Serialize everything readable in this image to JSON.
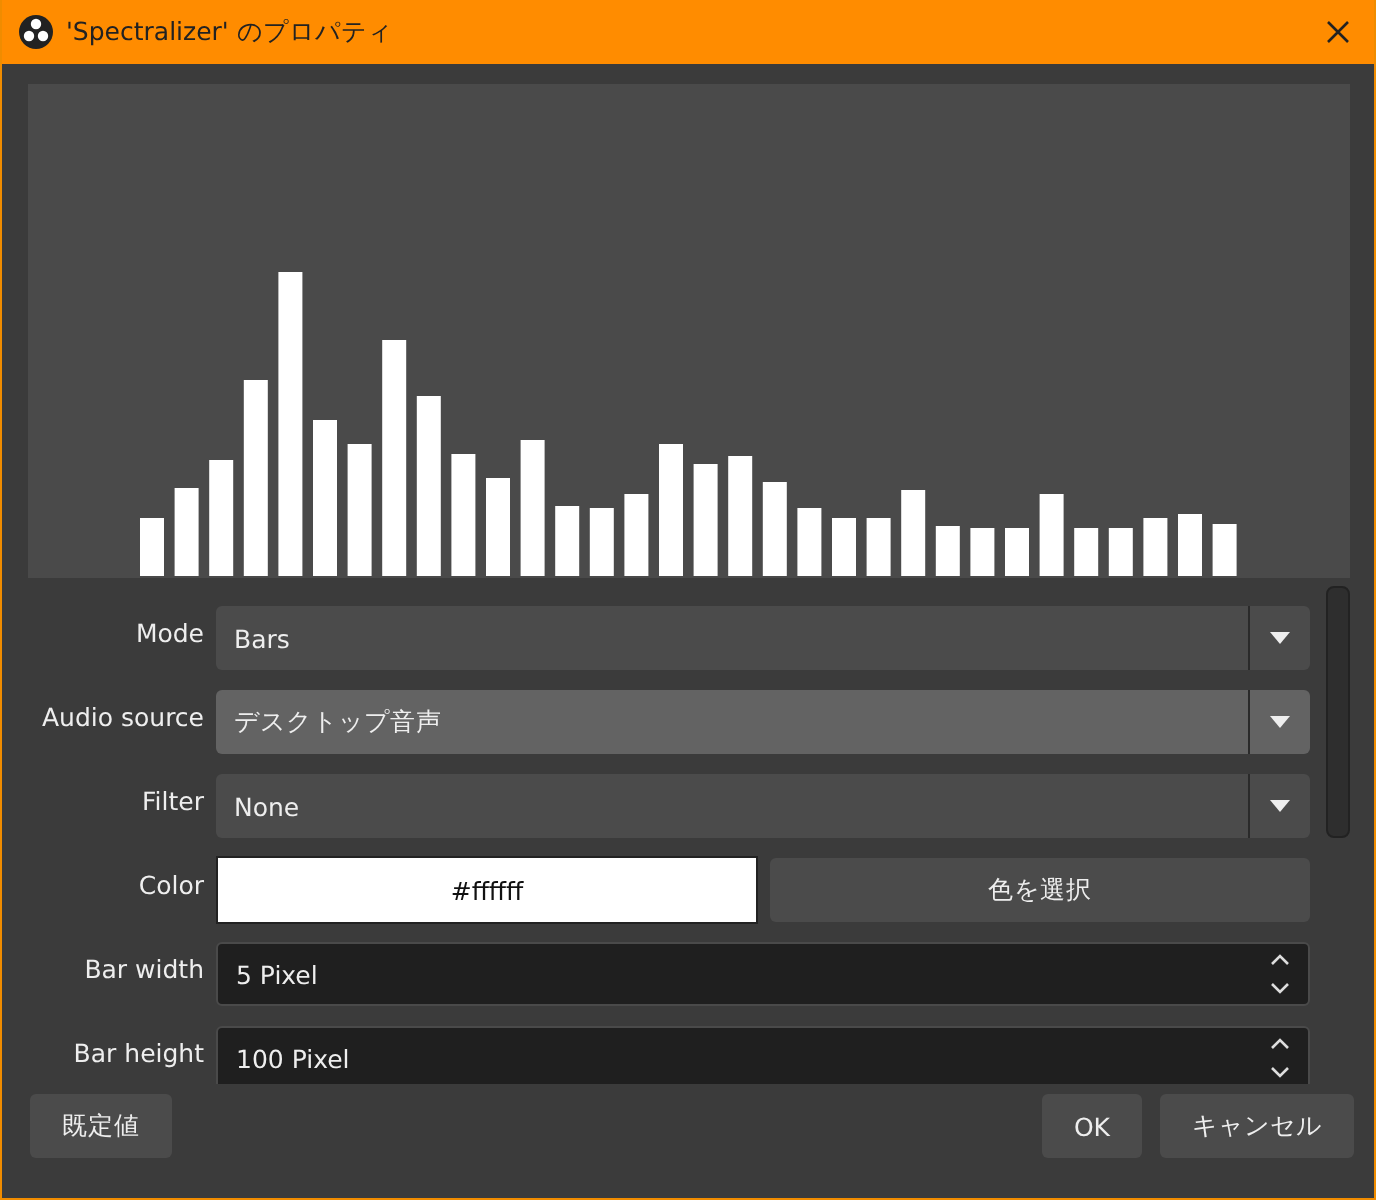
{
  "window": {
    "title": "'Spectralizer' のプロパティ"
  },
  "fields": [
    {
      "kind": "combo",
      "label": "Mode",
      "value": "Bars",
      "highlighted": false
    },
    {
      "kind": "combo",
      "label": "Audio source",
      "value": "デスクトップ音声",
      "highlighted": true
    },
    {
      "kind": "combo",
      "label": "Filter",
      "value": "None",
      "highlighted": false
    },
    {
      "kind": "color",
      "label": "Color",
      "value": "#ffffff",
      "button": "色を選択"
    },
    {
      "kind": "spin",
      "label": "Bar width",
      "value": "5 Pixel"
    },
    {
      "kind": "spin",
      "label": "Bar height",
      "value": "100 Pixel"
    }
  ],
  "buttons": {
    "defaults": "既定値",
    "ok": "OK",
    "cancel": "キャンセル"
  }
}
